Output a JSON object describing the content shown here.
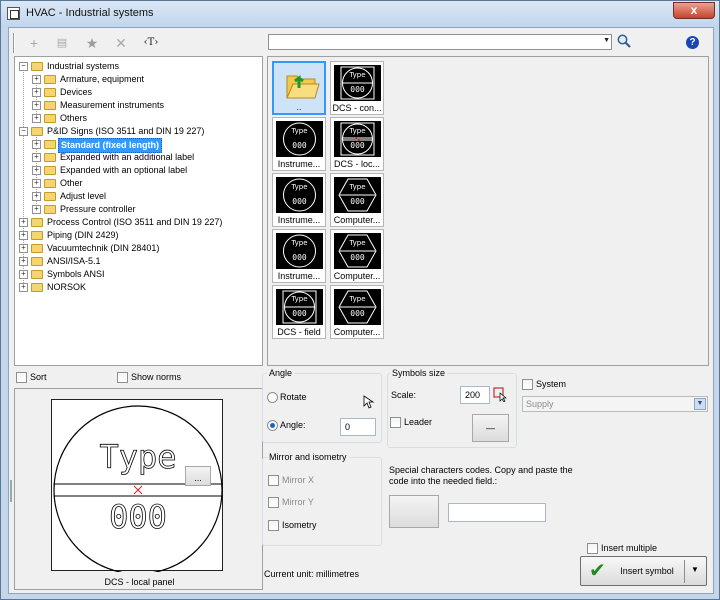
{
  "window": {
    "title": "HVAC - Industrial systems",
    "close_symbol": "x"
  },
  "toolbar": {
    "add_symbol": "+",
    "properties_symbol": "▤",
    "favorite_symbol": "★",
    "delete_symbol": "✕",
    "text_symbol": "‹T›",
    "search_value": "",
    "search_placeholder": "",
    "help_symbol": "?"
  },
  "tree": {
    "items": [
      {
        "label": "Industrial systems",
        "level": 0,
        "expanded": true
      },
      {
        "label": "Armature, equipment",
        "level": 1
      },
      {
        "label": "Devices",
        "level": 1
      },
      {
        "label": "Measurement instruments",
        "level": 1
      },
      {
        "label": "Others",
        "level": 1
      },
      {
        "label": "P&ID Signs (ISO 3511 and DIN 19 227)",
        "level": 0,
        "expanded": true
      },
      {
        "label": "Standard (fixed length)",
        "level": 1,
        "selected": true
      },
      {
        "label": "Expanded with an additional label",
        "level": 1
      },
      {
        "label": "Expanded with an optional label",
        "level": 1
      },
      {
        "label": "Other",
        "level": 1
      },
      {
        "label": "Adjust level",
        "level": 1
      },
      {
        "label": "Pressure controller",
        "level": 1
      },
      {
        "label": "Process Control (ISO 3511 and DIN 19 227)",
        "level": 0
      },
      {
        "label": "Piping (DIN 2429)",
        "level": 0
      },
      {
        "label": "Vacuumtechnik (DIN 28401)",
        "level": 0
      },
      {
        "label": "ANSI/ISA-5.1",
        "level": 0
      },
      {
        "label": "Symbols ANSI",
        "level": 0
      },
      {
        "label": "NORSOK",
        "level": 0
      }
    ]
  },
  "symbols": {
    "thumb_type_text": "Type",
    "thumb_num_text": "000",
    "items": [
      {
        "caption": "..",
        "kind": "up-folder"
      },
      {
        "caption": "DCS - con...",
        "kind": "square-circle"
      },
      {
        "caption": "Instrume...",
        "kind": "circle"
      },
      {
        "caption": "DCS - loc...",
        "kind": "square-circle-line"
      },
      {
        "caption": "Instrume...",
        "kind": "circle"
      },
      {
        "caption": "Computer...",
        "kind": "hexagon"
      },
      {
        "caption": "Instrume...",
        "kind": "circle"
      },
      {
        "caption": "Computer...",
        "kind": "hexagon"
      },
      {
        "caption": "DCS - field",
        "kind": "square-circle"
      },
      {
        "caption": "Computer...",
        "kind": "hexagon"
      }
    ]
  },
  "options": {
    "sort_label": "Sort",
    "show_norms_label": "Show norms"
  },
  "preview": {
    "type_text": "Type",
    "num_text": "000",
    "caption": "DCS - local panel",
    "more_button_label": "..."
  },
  "angle": {
    "group_title": "Angle",
    "rotate_label": "Rotate",
    "angle_label": "Angle:",
    "angle_value": "0"
  },
  "mirror": {
    "group_title": "Mirror and isometry",
    "mirror_x_label": "Mirror X",
    "mirror_y_label": "Mirror Y",
    "isometry_label": "Isometry"
  },
  "size": {
    "group_title": "Symbols size",
    "scale_label": "Scale:",
    "scale_value": "200",
    "leader_label": "Leader",
    "leader_button_label": "—"
  },
  "system": {
    "label": "System",
    "selected_value": "Supply"
  },
  "special": {
    "text": "Special characters codes. Copy and paste the code into the needed field.:",
    "code_value": ""
  },
  "footer": {
    "current_unit_text": "Current unit: millimetres",
    "insert_multiple_label": "Insert multiple",
    "insert_button_label": "Insert symbol"
  }
}
